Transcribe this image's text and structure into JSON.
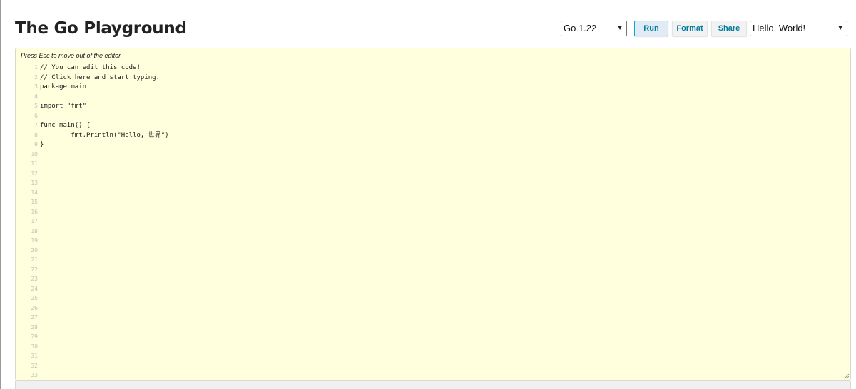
{
  "header": {
    "title": "The Go Playground"
  },
  "controls": {
    "version_select": {
      "value": "Go 1.22"
    },
    "run_label": "Run",
    "format_label": "Format",
    "share_label": "Share",
    "example_select": {
      "value": "Hello, World!"
    }
  },
  "editor": {
    "hint": "Press Esc to move out of the editor.",
    "lines": [
      {
        "num": "1",
        "code": "// You can edit this code!"
      },
      {
        "num": "2",
        "code": "// Click here and start typing."
      },
      {
        "num": "3",
        "code": "package main"
      },
      {
        "num": "4",
        "code": ""
      },
      {
        "num": "5",
        "code": "import \"fmt\""
      },
      {
        "num": "6",
        "code": ""
      },
      {
        "num": "7",
        "code": "func main() {"
      },
      {
        "num": "8",
        "code": "\tfmt.Println(\"Hello, 世界\")"
      },
      {
        "num": "9",
        "code": "}"
      },
      {
        "num": "10",
        "code": ""
      },
      {
        "num": "11",
        "code": ""
      },
      {
        "num": "12",
        "code": ""
      },
      {
        "num": "13",
        "code": ""
      },
      {
        "num": "14",
        "code": ""
      },
      {
        "num": "15",
        "code": ""
      },
      {
        "num": "16",
        "code": ""
      },
      {
        "num": "17",
        "code": ""
      },
      {
        "num": "18",
        "code": ""
      },
      {
        "num": "19",
        "code": ""
      },
      {
        "num": "20",
        "code": ""
      },
      {
        "num": "21",
        "code": ""
      },
      {
        "num": "22",
        "code": ""
      },
      {
        "num": "23",
        "code": ""
      },
      {
        "num": "24",
        "code": ""
      },
      {
        "num": "25",
        "code": ""
      },
      {
        "num": "26",
        "code": ""
      },
      {
        "num": "27",
        "code": ""
      },
      {
        "num": "28",
        "code": ""
      },
      {
        "num": "29",
        "code": ""
      },
      {
        "num": "30",
        "code": ""
      },
      {
        "num": "31",
        "code": ""
      },
      {
        "num": "32",
        "code": ""
      },
      {
        "num": "33",
        "code": ""
      }
    ]
  },
  "icons": {
    "select_arrow": "chevron-down-icon",
    "resize": "resize-grip-icon"
  },
  "colors": {
    "editor_bg": "#ffffdd",
    "button_text": "#007d9c",
    "run_border": "#00add8"
  }
}
